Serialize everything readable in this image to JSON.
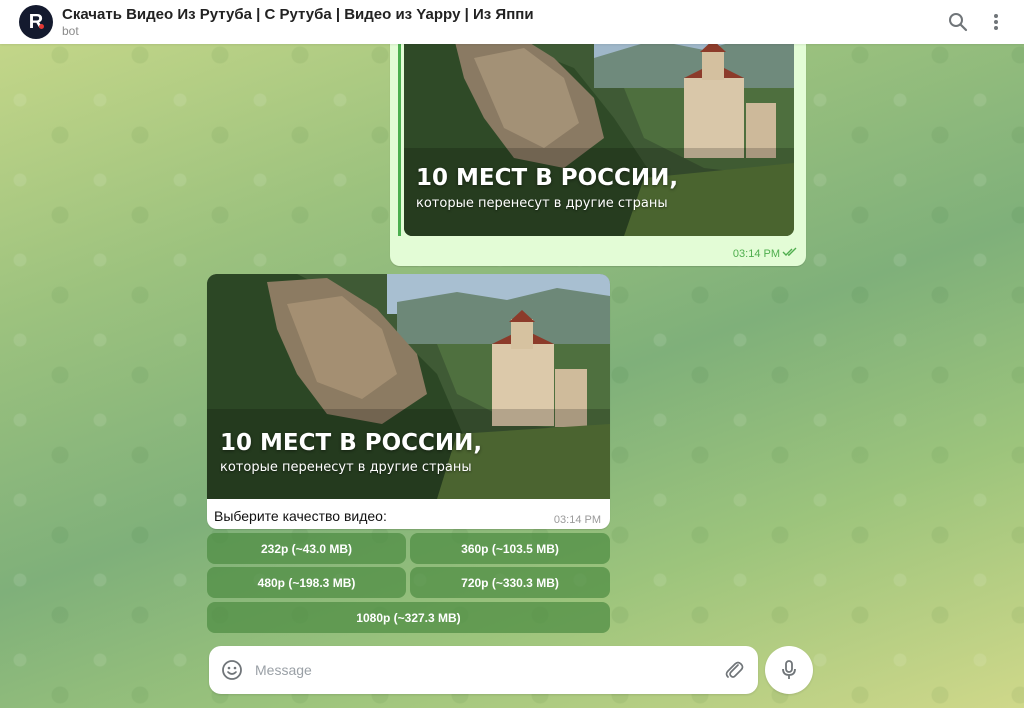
{
  "header": {
    "avatar_letter": "R",
    "title": "Скачать Видео Из Рутуба | С Рутуба | Видео из Yappy | Из Яппи",
    "subtitle": "bot",
    "icons": [
      "search-icon",
      "more-vertical-icon"
    ]
  },
  "messages": {
    "outgoing": {
      "overlay_title": "10 МЕСТ В РОССИИ,",
      "overlay_subtitle": "которые перенесут в другие страны",
      "time": "03:14 PM",
      "status_icon": "double-check-icon"
    },
    "incoming": {
      "overlay_title": "10 МЕСТ В РОССИИ,",
      "overlay_subtitle": "которые перенесут в другие страны",
      "text": "Выберите качество видео:",
      "time": "03:14 PM"
    }
  },
  "quality_buttons": [
    {
      "label": "232p (~43.0 MB)"
    },
    {
      "label": "360p (~103.5 MB)"
    },
    {
      "label": "480p (~198.3 MB)"
    },
    {
      "label": "720p (~330.3 MB)"
    },
    {
      "label": "1080p (~327.3 MB)"
    }
  ],
  "composer": {
    "placeholder": "Message",
    "value": ""
  },
  "colors": {
    "accent_green": "#4caf50",
    "button_green": "#4e8c42",
    "outgoing_bubble": "#e3fcd6"
  }
}
